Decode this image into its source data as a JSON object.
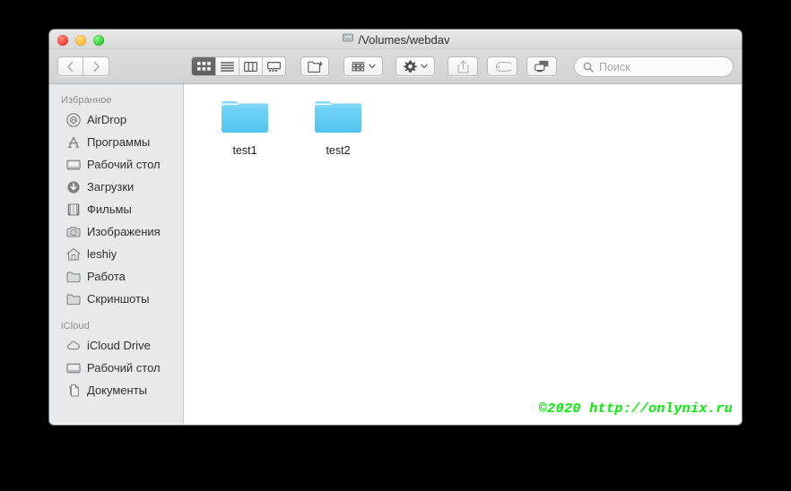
{
  "window": {
    "title": "/Volumes/webdav",
    "title_icon": "disk-drive-icon",
    "traffic_lights": [
      {
        "name": "close",
        "color": "#fb3b30"
      },
      {
        "name": "minimize",
        "color": "#fdbc2c"
      },
      {
        "name": "zoom",
        "color": "#29cb32"
      }
    ]
  },
  "toolbar": {
    "back_label": "‹",
    "forward_label": "›",
    "view_modes": [
      {
        "name": "icon-view",
        "icon": "grid-icon",
        "active": true
      },
      {
        "name": "list-view",
        "icon": "list-icon",
        "active": false
      },
      {
        "name": "column-view",
        "icon": "columns-icon",
        "active": false
      },
      {
        "name": "gallery-view",
        "icon": "gallery-icon",
        "active": false
      }
    ],
    "new_folder_icon": "new-folder-icon",
    "arrange_icon": "arrange-grid-icon",
    "action_icon": "gear-icon",
    "share_icon": "share-icon",
    "tags_icon": "tag-icon",
    "connect_icon": "airdrop-screens-icon",
    "chevron_icon": "chevron-down-icon"
  },
  "search": {
    "icon": "search-icon",
    "placeholder": "Поиск",
    "value": ""
  },
  "sidebar": {
    "sections": [
      {
        "header": "Избранное",
        "items": [
          {
            "label": "AirDrop",
            "icon": "airdrop-icon"
          },
          {
            "label": "Программы",
            "icon": "applications-icon"
          },
          {
            "label": "Рабочий стол",
            "icon": "desktop-icon"
          },
          {
            "label": "Загрузки",
            "icon": "downloads-icon"
          },
          {
            "label": "Фильмы",
            "icon": "movies-icon"
          },
          {
            "label": "Изображения",
            "icon": "pictures-icon"
          },
          {
            "label": "leshiy",
            "icon": "home-icon"
          },
          {
            "label": "Работа",
            "icon": "folder-icon"
          },
          {
            "label": "Скриншоты",
            "icon": "folder-icon"
          }
        ]
      },
      {
        "header": "iCloud",
        "items": [
          {
            "label": "iCloud Drive",
            "icon": "cloud-icon"
          },
          {
            "label": "Рабочий стол",
            "icon": "desktop-icon"
          },
          {
            "label": "Документы",
            "icon": "documents-icon"
          }
        ]
      }
    ]
  },
  "content": {
    "files": [
      {
        "name": "test1",
        "type": "folder"
      },
      {
        "name": "test2",
        "type": "folder"
      }
    ],
    "folder_color": "#5ec8f2"
  },
  "watermark": {
    "text": "©2020 http://onlynix.ru",
    "color": "#00f000"
  }
}
